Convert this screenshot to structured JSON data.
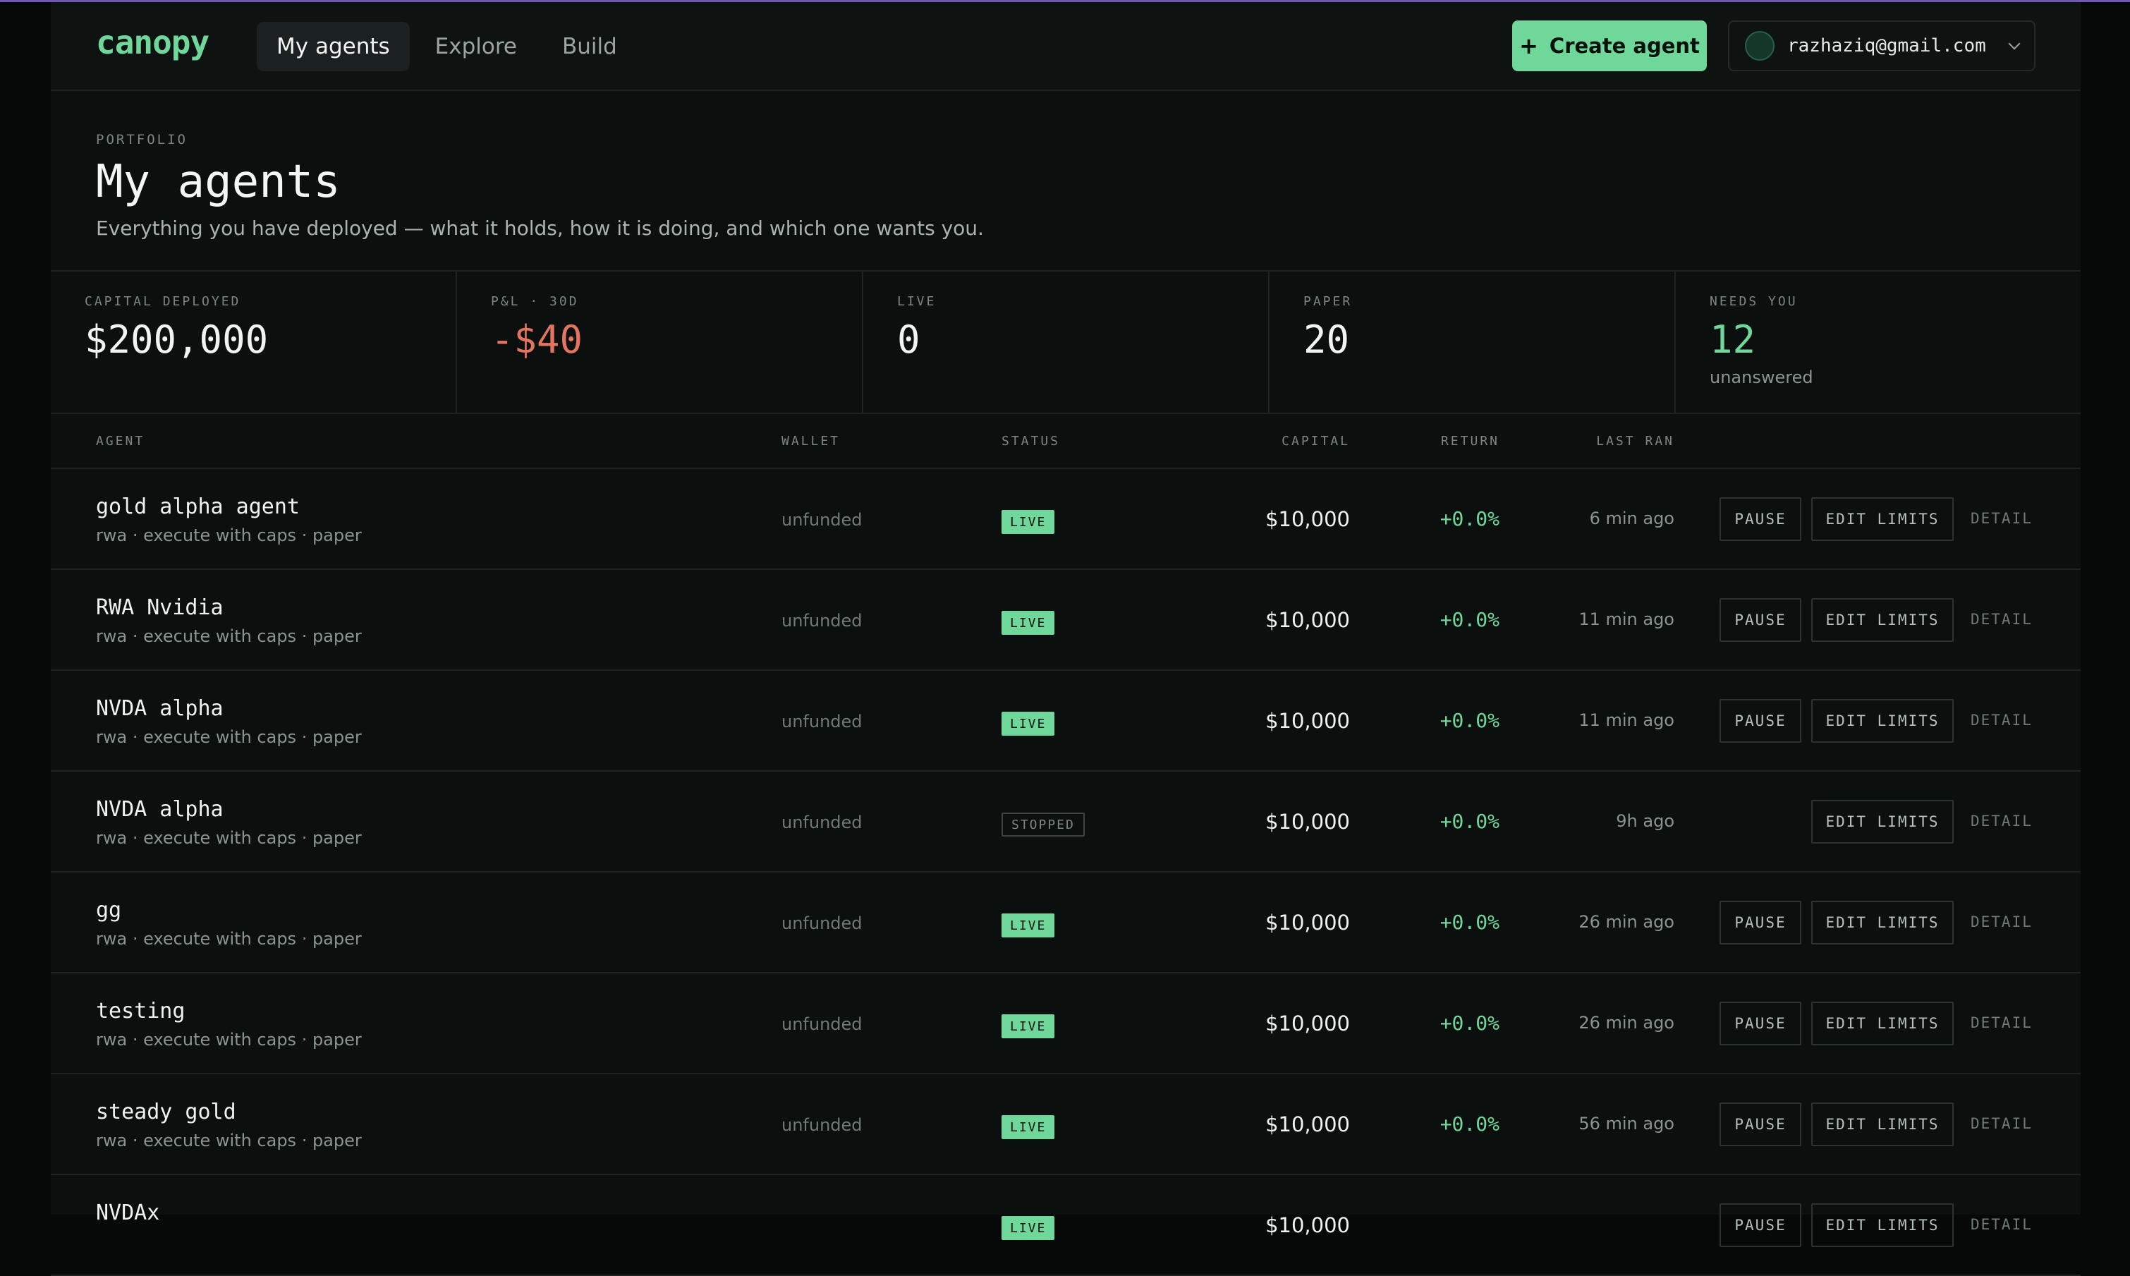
{
  "header": {
    "logo": "canopy",
    "nav": [
      {
        "label": "My agents",
        "active": true
      },
      {
        "label": "Explore",
        "active": false
      },
      {
        "label": "Build",
        "active": false
      }
    ],
    "create_label": "Create agent",
    "create_icon": "plus-icon",
    "user_email": "razhaziq@gmail.com"
  },
  "intro": {
    "eyebrow": "PORTFOLIO",
    "title": "My agents",
    "subtitle": "Everything you have deployed — what it holds, how it is doing, and which one wants you."
  },
  "stats": [
    {
      "label": "CAPITAL DEPLOYED",
      "value": "$200,000",
      "note": ""
    },
    {
      "label": "P&L · 30D",
      "value": "-$40",
      "note": ""
    },
    {
      "label": "LIVE",
      "value": "0",
      "note": ""
    },
    {
      "label": "PAPER",
      "value": "20",
      "note": ""
    },
    {
      "label": "NEEDS YOU",
      "value": "12",
      "note": "unanswered"
    }
  ],
  "table": {
    "columns": {
      "agent": "AGENT",
      "wallet": "WALLET",
      "status": "STATUS",
      "capital": "CAPITAL",
      "return": "RETURN",
      "last_ran": "LAST RAN"
    },
    "action_labels": {
      "pause": "PAUSE",
      "edit": "EDIT LIMITS",
      "detail": "DETAIL"
    },
    "rows": [
      {
        "name": "gold alpha agent",
        "meta": "rwa · execute with caps · paper",
        "wallet": "unfunded",
        "status": "LIVE",
        "capital": "$10,000",
        "return": "+0.0%",
        "last_ran": "6 min ago"
      },
      {
        "name": "RWA Nvidia",
        "meta": "rwa · execute with caps · paper",
        "wallet": "unfunded",
        "status": "LIVE",
        "capital": "$10,000",
        "return": "+0.0%",
        "last_ran": "11 min ago"
      },
      {
        "name": "NVDA alpha",
        "meta": "rwa · execute with caps · paper",
        "wallet": "unfunded",
        "status": "LIVE",
        "capital": "$10,000",
        "return": "+0.0%",
        "last_ran": "11 min ago"
      },
      {
        "name": "NVDA alpha",
        "meta": "rwa · execute with caps · paper",
        "wallet": "unfunded",
        "status": "STOPPED",
        "capital": "$10,000",
        "return": "+0.0%",
        "last_ran": "9h ago"
      },
      {
        "name": "gg",
        "meta": "rwa · execute with caps · paper",
        "wallet": "unfunded",
        "status": "LIVE",
        "capital": "$10,000",
        "return": "+0.0%",
        "last_ran": "26 min ago"
      },
      {
        "name": "testing",
        "meta": "rwa · execute with caps · paper",
        "wallet": "unfunded",
        "status": "LIVE",
        "capital": "$10,000",
        "return": "+0.0%",
        "last_ran": "26 min ago"
      },
      {
        "name": "steady gold",
        "meta": "rwa · execute with caps · paper",
        "wallet": "unfunded",
        "status": "LIVE",
        "capital": "$10,000",
        "return": "+0.0%",
        "last_ran": "56 min ago"
      },
      {
        "name": "NVDAx",
        "meta": "",
        "wallet": "",
        "status": "LIVE",
        "capital": "$10,000",
        "return": "",
        "last_ran": ""
      }
    ]
  },
  "colors": {
    "accent": "#6fd79a",
    "negative": "#e37560",
    "background": "#0b0f0e"
  }
}
